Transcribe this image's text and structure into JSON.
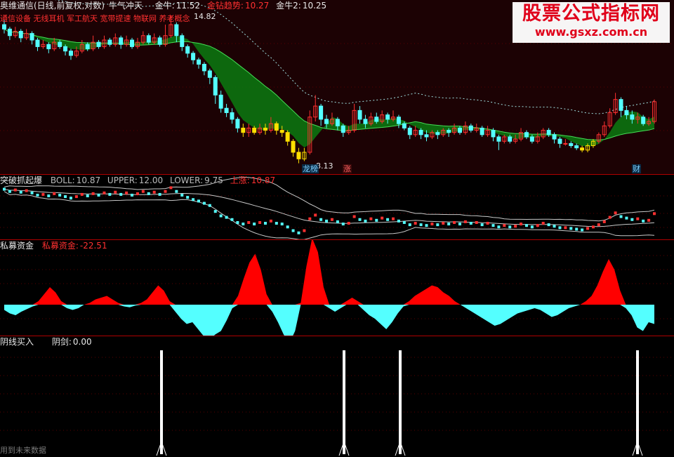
{
  "main_header": {
    "name": "奥维通信(日线,前复权,对数)",
    "indicator": "牛气冲天",
    "items": [
      {
        "label": "金牛:",
        "value": "11.52",
        "color": "#e8e8e8"
      },
      {
        "label": "金钻趋势:",
        "value": "10.27",
        "color": "#ff3030"
      },
      {
        "label": "金牛2:",
        "value": "10.25",
        "color": "#e8e8e8"
      }
    ],
    "concepts": "通信设备 无线耳机 军工航天 宽带提速 物联网 养老概念",
    "high_label": "14.82",
    "low_label": "8.13",
    "tags": [
      {
        "text": "龙榜",
        "color": "#7fd0ff"
      },
      {
        "text": "涨",
        "color": "#ff6060"
      },
      {
        "text": "财",
        "color": "#7fd0ff"
      }
    ]
  },
  "boll_header": {
    "name": "突破抓起爆",
    "boll_label": "BOLL:",
    "boll": "10.87",
    "upper_label": "UPPER:",
    "upper": "12.00",
    "lower_label": "LOWER:",
    "lower": "9.75",
    "up_label": "上涨:",
    "up": "10.87"
  },
  "fund_header": {
    "name": "私募资金",
    "label": "私募资金:",
    "value": "-22.51"
  },
  "sig_header": {
    "name": "阴线买入",
    "label": "阴剑:",
    "value": "0.00"
  },
  "footer": "用到未来数据",
  "watermark": {
    "title": "股票公式指标网",
    "url": "www.gsxz.com.cn"
  },
  "colors": {
    "up": "#ff3030",
    "down": "#54ffff",
    "band": "#0a7a10",
    "yellow": "#ffe000",
    "fund_pos": "#ff0000",
    "fund_neg": "#54ffff"
  },
  "chart_data": {
    "type": "candlestick",
    "price_ylim": [
      7.8,
      15.2
    ],
    "candles": [
      [
        14.4,
        14.2,
        14.6,
        14.0
      ],
      [
        14.2,
        13.9,
        14.3,
        13.7
      ],
      [
        13.9,
        14.1,
        14.3,
        13.8
      ],
      [
        14.1,
        13.8,
        14.2,
        13.6
      ],
      [
        13.8,
        14.0,
        14.2,
        13.7
      ],
      [
        14.0,
        13.7,
        14.1,
        13.5
      ],
      [
        13.7,
        13.4,
        13.8,
        13.2
      ],
      [
        13.4,
        13.5,
        13.7,
        13.3
      ],
      [
        13.5,
        13.3,
        13.6,
        13.1
      ],
      [
        13.3,
        13.6,
        13.8,
        13.2
      ],
      [
        13.6,
        13.4,
        13.7,
        13.3
      ],
      [
        13.4,
        13.2,
        13.5,
        13.0
      ],
      [
        13.2,
        13.0,
        13.3,
        12.8
      ],
      [
        13.0,
        13.2,
        13.4,
        12.9
      ],
      [
        13.2,
        13.5,
        13.7,
        13.1
      ],
      [
        13.5,
        13.3,
        13.6,
        13.2
      ],
      [
        13.3,
        13.6,
        13.9,
        13.2
      ],
      [
        13.6,
        13.4,
        13.7,
        13.3
      ],
      [
        13.4,
        13.7,
        13.9,
        13.3
      ],
      [
        13.7,
        13.5,
        13.8,
        13.4
      ],
      [
        13.5,
        13.8,
        14.0,
        13.4
      ],
      [
        13.8,
        13.5,
        13.9,
        13.3
      ],
      [
        13.5,
        13.7,
        13.9,
        13.4
      ],
      [
        13.7,
        13.4,
        13.8,
        13.3
      ],
      [
        13.4,
        13.6,
        13.8,
        13.3
      ],
      [
        13.6,
        13.9,
        14.1,
        13.5
      ],
      [
        13.9,
        13.6,
        14.0,
        13.5
      ],
      [
        13.6,
        13.8,
        14.0,
        13.5
      ],
      [
        13.8,
        13.5,
        13.9,
        13.4
      ],
      [
        13.5,
        13.9,
        14.4,
        13.4
      ],
      [
        13.9,
        14.4,
        14.8,
        13.8
      ],
      [
        14.4,
        13.9,
        14.5,
        13.6
      ],
      [
        13.9,
        13.4,
        14.0,
        13.2
      ],
      [
        13.4,
        13.1,
        13.5,
        12.9
      ],
      [
        13.1,
        12.8,
        13.2,
        12.6
      ],
      [
        12.8,
        12.6,
        12.9,
        12.4
      ],
      [
        12.6,
        12.3,
        12.7,
        12.1
      ],
      [
        12.3,
        12.0,
        12.4,
        11.7
      ],
      [
        12.0,
        11.2,
        12.1,
        10.8
      ],
      [
        11.2,
        10.6,
        11.4,
        10.4
      ],
      [
        10.6,
        10.4,
        10.8,
        10.2
      ],
      [
        10.4,
        10.1,
        10.6,
        9.9
      ],
      [
        10.1,
        9.7,
        10.2,
        9.5
      ],
      [
        9.7,
        9.5,
        9.9,
        9.3
      ],
      [
        9.5,
        9.7,
        9.9,
        9.3
      ],
      [
        9.7,
        9.5,
        9.8,
        9.4
      ],
      [
        9.5,
        9.7,
        9.9,
        9.4
      ],
      [
        9.7,
        9.6,
        9.9,
        9.4
      ],
      [
        9.6,
        9.9,
        10.2,
        9.5
      ],
      [
        9.9,
        9.6,
        10.0,
        9.4
      ],
      [
        9.6,
        9.5,
        9.8,
        9.3
      ],
      [
        9.5,
        9.1,
        9.6,
        8.9
      ],
      [
        9.1,
        8.6,
        9.2,
        8.4
      ],
      [
        8.6,
        8.3,
        8.8,
        8.1
      ],
      [
        8.3,
        8.6,
        8.8,
        8.2
      ],
      [
        8.6,
        10.2,
        10.5,
        8.5
      ],
      [
        10.2,
        10.7,
        11.2,
        10.0
      ],
      [
        10.7,
        10.1,
        10.8,
        9.8
      ],
      [
        10.1,
        9.9,
        10.3,
        9.7
      ],
      [
        9.9,
        10.1,
        10.4,
        9.8
      ],
      [
        10.1,
        9.8,
        10.2,
        9.6
      ],
      [
        9.8,
        9.5,
        9.9,
        9.3
      ],
      [
        9.5,
        9.6,
        9.8,
        9.4
      ],
      [
        9.6,
        10.5,
        10.8,
        9.5
      ],
      [
        10.5,
        10.1,
        10.7,
        9.9
      ],
      [
        10.1,
        9.9,
        10.3,
        9.7
      ],
      [
        9.9,
        10.2,
        10.4,
        9.8
      ],
      [
        10.2,
        10.0,
        10.4,
        9.9
      ],
      [
        10.0,
        10.3,
        10.5,
        9.9
      ],
      [
        10.3,
        10.1,
        10.4,
        9.9
      ],
      [
        10.1,
        10.2,
        10.5,
        10.0
      ],
      [
        10.2,
        9.9,
        10.3,
        9.7
      ],
      [
        9.9,
        9.7,
        10.0,
        9.6
      ],
      [
        9.7,
        9.4,
        9.8,
        9.2
      ],
      [
        9.4,
        9.6,
        9.8,
        9.3
      ],
      [
        9.6,
        9.4,
        9.7,
        9.2
      ],
      [
        9.4,
        9.3,
        9.6,
        9.1
      ],
      [
        9.3,
        9.5,
        9.6,
        9.2
      ],
      [
        9.5,
        9.4,
        9.6,
        9.2
      ],
      [
        9.4,
        9.6,
        9.7,
        9.3
      ],
      [
        9.6,
        9.5,
        9.7,
        9.3
      ],
      [
        9.5,
        9.7,
        9.9,
        9.4
      ],
      [
        9.7,
        9.5,
        9.8,
        9.4
      ],
      [
        9.5,
        9.8,
        10.0,
        9.4
      ],
      [
        9.8,
        9.6,
        9.9,
        9.5
      ],
      [
        9.6,
        9.7,
        9.9,
        9.5
      ],
      [
        9.7,
        9.4,
        9.8,
        9.3
      ],
      [
        9.4,
        9.6,
        9.8,
        9.3
      ],
      [
        9.6,
        9.3,
        9.7,
        9.1
      ],
      [
        9.3,
        9.1,
        9.4,
        8.7
      ],
      [
        9.1,
        9.3,
        9.4,
        9.0
      ],
      [
        9.3,
        9.1,
        9.4,
        9.0
      ],
      [
        9.1,
        9.2,
        9.4,
        9.0
      ],
      [
        9.2,
        9.5,
        9.7,
        9.1
      ],
      [
        9.5,
        9.3,
        9.6,
        9.2
      ],
      [
        9.3,
        9.1,
        9.4,
        9.0
      ],
      [
        9.1,
        9.3,
        9.5,
        9.0
      ],
      [
        9.3,
        9.6,
        9.7,
        9.2
      ],
      [
        9.6,
        9.4,
        9.7,
        9.3
      ],
      [
        9.4,
        9.2,
        9.5,
        9.0
      ],
      [
        9.2,
        9.0,
        9.3,
        8.8
      ],
      [
        9.0,
        9.0,
        9.2,
        8.9
      ],
      [
        9.0,
        8.9,
        9.1,
        8.8
      ],
      [
        8.9,
        8.8,
        9.0,
        8.7
      ],
      [
        8.8,
        8.7,
        8.9,
        8.6
      ],
      [
        8.7,
        8.9,
        9.0,
        8.6
      ],
      [
        8.9,
        9.1,
        9.2,
        8.8
      ],
      [
        9.1,
        9.4,
        9.5,
        9.0
      ],
      [
        9.4,
        9.8,
        10.0,
        9.3
      ],
      [
        9.8,
        10.4,
        10.6,
        9.7
      ],
      [
        10.4,
        11.0,
        11.3,
        10.3
      ],
      [
        11.0,
        10.5,
        11.1,
        10.2
      ],
      [
        10.5,
        10.3,
        10.7,
        10.1
      ],
      [
        10.3,
        10.1,
        10.5,
        9.9
      ],
      [
        10.1,
        10.2,
        10.4,
        9.9
      ],
      [
        10.2,
        9.9,
        10.3,
        9.8
      ],
      [
        9.9,
        10.0,
        10.2,
        9.8
      ],
      [
        10.0,
        10.9,
        11.0,
        9.9
      ]
    ],
    "fund_series": [
      -6,
      -10,
      -12,
      -8,
      -5,
      -2,
      4,
      12,
      20,
      14,
      4,
      -4,
      -6,
      -4,
      0,
      2,
      6,
      8,
      10,
      6,
      2,
      -2,
      -3,
      -1,
      2,
      6,
      14,
      22,
      16,
      4,
      -8,
      -16,
      -22,
      -20,
      -28,
      -36,
      -40,
      -34,
      -30,
      -18,
      -4,
      10,
      30,
      48,
      58,
      40,
      12,
      -8,
      -20,
      -34,
      -44,
      -30,
      2,
      44,
      76,
      60,
      20,
      -4,
      -8,
      -4,
      4,
      8,
      4,
      -6,
      -12,
      -16,
      -22,
      -28,
      -20,
      -10,
      -2,
      4,
      10,
      14,
      18,
      22,
      20,
      14,
      10,
      4,
      0,
      -4,
      -8,
      -12,
      -16,
      -20,
      -24,
      -22,
      -18,
      -14,
      -10,
      -8,
      -6,
      -4,
      -6,
      -10,
      -14,
      -12,
      -8,
      -4,
      -2,
      0,
      4,
      10,
      22,
      38,
      52,
      40,
      16,
      -4,
      -12,
      -26,
      -30,
      -20,
      -22
    ]
  }
}
